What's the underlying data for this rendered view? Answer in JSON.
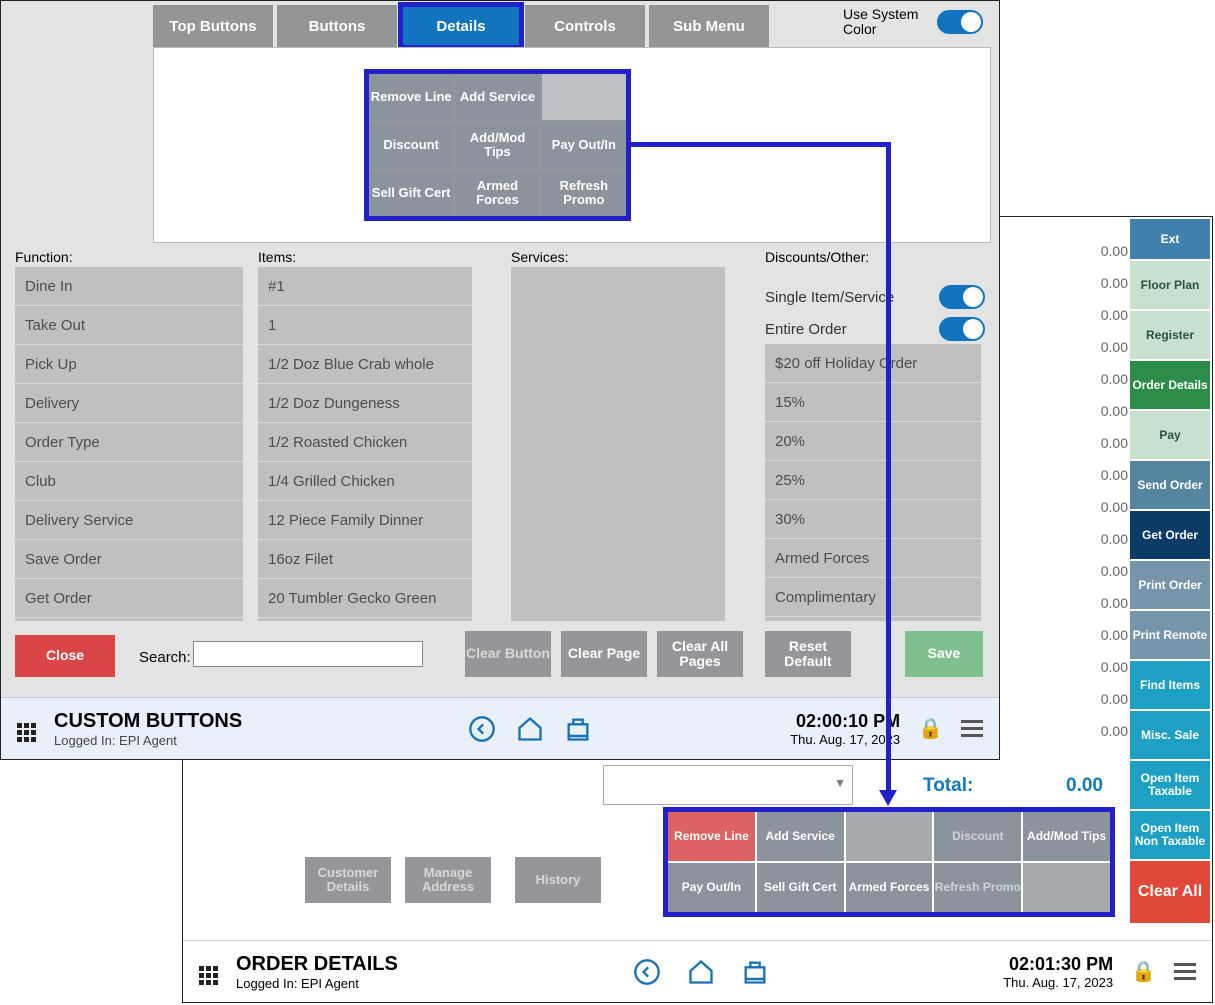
{
  "win1": {
    "tabs": [
      "Top Buttons",
      "Buttons",
      "Details",
      "Controls",
      "Sub Menu"
    ],
    "use_system_color_label": "Use System Color",
    "grid9": [
      "Remove Line",
      "Add Service",
      "",
      "Discount",
      "Add/Mod Tips",
      "Pay Out/In",
      "Sell Gift Cert",
      "Armed Forces",
      "Refresh Promo"
    ],
    "labels": {
      "function": "Function:",
      "items": "Items:",
      "services": "Services:",
      "discounts": "Discounts/Other:"
    },
    "functions": [
      "Dine In",
      "Take Out",
      "Pick Up",
      "Delivery",
      "Order Type",
      "Club",
      "Delivery Service",
      "Save Order",
      "Get Order"
    ],
    "items": [
      "#1",
      "1",
      "1/2 Doz Blue Crab whole",
      "1/2 Doz Dungeness",
      "1/2 Roasted Chicken",
      "1/4 Grilled Chicken",
      "12 Piece Family Dinner",
      "16oz Filet",
      "20 Tumbler Gecko Green"
    ],
    "disc_toggles": {
      "single": "Single Item/Service",
      "entire": "Entire Order"
    },
    "discounts": [
      "$20 off Holiday Order",
      "15%",
      "20%",
      "25%",
      "30%",
      "Armed Forces",
      "Complimentary"
    ],
    "buttons": {
      "close": "Close",
      "search": "Search:",
      "clear_button": "Clear Button",
      "clear_page": "Clear Page",
      "clear_all": "Clear All Pages",
      "reset": "Reset Default",
      "save": "Save"
    },
    "status": {
      "title": "CUSTOM BUTTONS",
      "logged": "Logged In:  EPI Agent",
      "time": "02:00:10 PM",
      "date": "Thu. Aug. 17, 2023"
    }
  },
  "win2": {
    "rail": {
      "ext": "Ext",
      "floorplan": "Floor Plan",
      "register": "Register",
      "orderdet": "Order Details",
      "pay": "Pay",
      "sendorder": "Send Order",
      "getorder": "Get Order",
      "printord": "Print Order",
      "printrem": "Print Remote",
      "finditems": "Find Items",
      "miscsale": "Misc. Sale",
      "openittax": "Open Item Taxable",
      "openitnon": "Open Item Non Taxable",
      "clearall": "Clear All"
    },
    "money_rows": [
      "0.00",
      "0.00",
      "0.00",
      "0.00",
      "0.00",
      "0.00",
      "0.00",
      "0.00",
      "0.00",
      "0.00",
      "0.00",
      "0.00",
      "0.00",
      "0.00",
      "0.00",
      "0.00"
    ],
    "total_label": "Total:",
    "total_value": "0.00",
    "ll": {
      "cust": "Customer Details",
      "addr": "Manage Address",
      "hist": "History"
    },
    "lowgrid": [
      "Remove Line",
      "Add Service",
      "",
      "Discount",
      "Add/Mod Tips",
      "Pay Out/In",
      "Sell Gift Cert",
      "Armed Forces",
      "Refresh Promo",
      ""
    ],
    "status": {
      "title": "ORDER DETAILS",
      "logged": "Logged In:  EPI Agent",
      "time": "02:01:30 PM",
      "date": "Thu. Aug. 17, 2023"
    }
  }
}
